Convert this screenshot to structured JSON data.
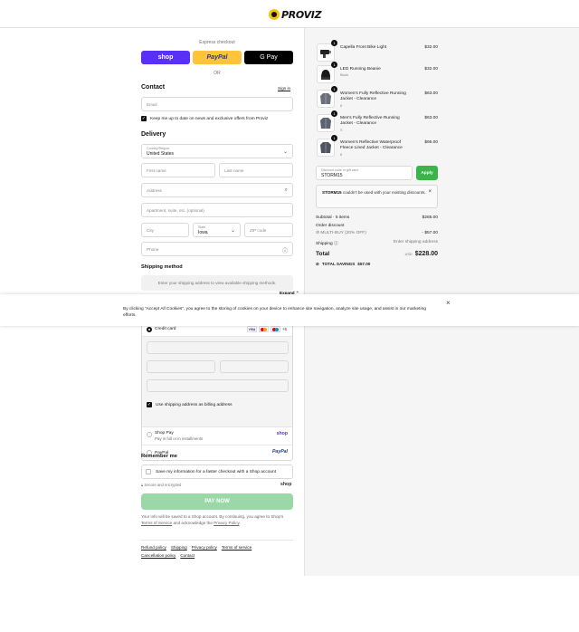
{
  "brand": {
    "logo_text": "PROVIZ"
  },
  "express": {
    "label": "Express checkout",
    "shop": "shop",
    "paypal": "PayPal",
    "gpay": "G Pay",
    "or": "OR"
  },
  "contact": {
    "heading": "Contact",
    "signin": "Sign in",
    "email_placeholder": "Email",
    "news_label": "Keep me up to date on news and exclusive offers from Proviz"
  },
  "delivery": {
    "heading": "Delivery",
    "country_label": "Country/Region",
    "country_value": "United States",
    "first_name": "First name",
    "last_name": "Last name",
    "address": "Address",
    "apartment": "Apartment, suite, etc. (optional)",
    "city": "City",
    "state_label": "State",
    "state_value": "Iowa",
    "zip": "ZIP code",
    "phone": "Phone"
  },
  "shipping_method": {
    "heading": "Shipping method",
    "note": "Enter your shipping address to view available shipping methods."
  },
  "expand": "Expand ⌃",
  "cookie": {
    "text": "By clicking “Accept All Cookies”, you agree to the storing of cookies on your device to enhance site navigation, analyze site usage, and assist in our marketing efforts.",
    "close": "×"
  },
  "payment": {
    "credit_card": "Credit card",
    "card_visa": "VISA",
    "more_cards": "+5",
    "billing_label": "Use shipping address as billing address",
    "shop_pay": "Shop Pay",
    "shop_pay_sub": "Pay in full or in installments",
    "shop_pay_logo": "shop",
    "paypal": "PayPal",
    "paypal_logo": "PayPal"
  },
  "remember": {
    "heading": "Remember me",
    "label": "Save my information for a faster checkout with a Shop account",
    "secure": "Secure and encrypted",
    "shop_logo": "shop"
  },
  "pay_now": "PAY NOW",
  "fine_print": {
    "part1": "Your info will be saved to a Shop account. By continuing, you agree to Shop’s ",
    "terms": "Terms of Service",
    "part2": " and acknowledge the ",
    "privacy": "Privacy Policy",
    "part3": "."
  },
  "footer_links": [
    "Refund policy",
    "Shipping",
    "Privacy policy",
    "Terms of service",
    "Cancellation policy",
    "Contact"
  ],
  "items": [
    {
      "name": "Capella Front Bike Light",
      "variant": "",
      "qty": "1",
      "price": "$32.00",
      "icon": "bike-light-icon"
    },
    {
      "name": "LED Running Beanie",
      "variant": "Black",
      "qty": "1",
      "price": "$32.00",
      "icon": "beanie-icon"
    },
    {
      "name": "Women's Fully Reflective Running Jacket - Clearance",
      "variant": "8",
      "qty": "1",
      "price": "$63.00",
      "icon": "jacket-icon"
    },
    {
      "name": "Men's Fully Reflective Running Jacket - Clearance",
      "variant": "S",
      "qty": "1",
      "price": "$63.00",
      "icon": "jacket-icon"
    },
    {
      "name": "Women's Reflective Waterproof Fleece Lined Jacket - Clearance",
      "variant": "8",
      "qty": "1",
      "price": "$95.00",
      "icon": "jacket-icon"
    }
  ],
  "discount": {
    "label": "Discount code or gift card",
    "value": "STORM15",
    "apply": "Apply",
    "msg_code": "STORM15",
    "msg_text": " couldn't be used with your existing discounts.",
    "close": "×"
  },
  "summary": {
    "subtotal_label": "Subtotal · 5 items",
    "subtotal_value": "$285.00",
    "order_discount_label": "Order discount",
    "multibuy_label": "MULTI-BUY (20% OFF)",
    "multibuy_value": "- $57.00",
    "shipping_label": "Shipping",
    "shipping_value": "Enter shipping address",
    "total_label": "Total",
    "currency": "USD",
    "total_value": "$228.00",
    "savings_label": "TOTAL SAVINGS",
    "savings_value": "$57.00"
  }
}
